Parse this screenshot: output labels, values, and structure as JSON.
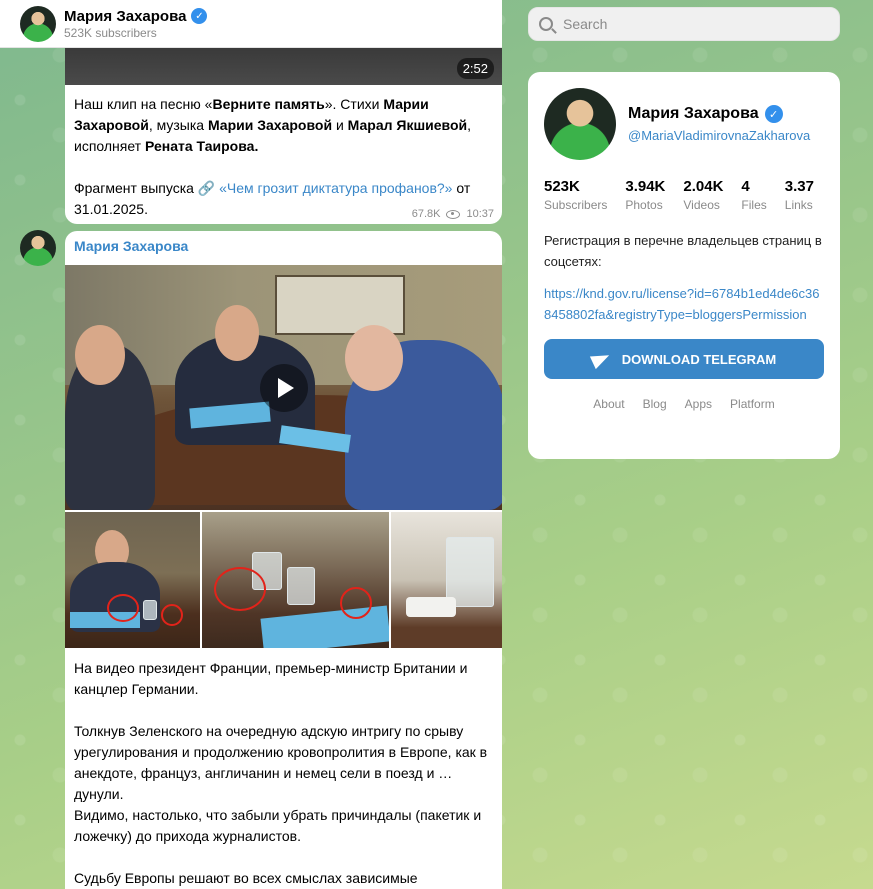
{
  "channel": {
    "name": "Мария Захарова",
    "subscribers_label": "523K subscribers",
    "handle": "@MariaVladimirovnaZakharova"
  },
  "post1": {
    "duration": "2:52",
    "line1_a": "Наш клип на песню «",
    "line1_b": "Верните память",
    "line1_c": "». Стихи ",
    "line1_d": "Марии",
    "line2_a": "Захаровой",
    "line2_b": ", музыка ",
    "line2_c": "Марии Захаровой",
    "line2_d": " и ",
    "line2_e": "Марал Якшиевой",
    "line2_f": ",",
    "line3_a": "исполняет ",
    "line3_b": "Рената Таирова.",
    "line4_a": "Фрагмент выпуска 🔗 ",
    "line4_link": "«Чем грозит диктатура профанов?»",
    "line4_b": " от",
    "line5": "31.01.2025.",
    "views": "67.8K",
    "time": "10:37"
  },
  "post2": {
    "author": "Мария Захарова",
    "p1": "На видео президент Франции, премьер-министр Британии и канцлер Германии.",
    "p2": "Толкнув Зеленского на очередную адскую интригу по срыву урегулирования и продолжению кровопролития в Европе, как в анекдоте, француз, англичанин и немец сели в поезд и … дунули.",
    "p3": "Видимо, настолько, что забыли убрать причиндалы (пакетик и ложечку) до прихода журналистов.",
    "p4": "Судьбу Европы решают во всех смыслах зависимые"
  },
  "search": {
    "placeholder": "Search"
  },
  "card": {
    "name": "Мария Захарова",
    "handle": "@MariaVladimirovnaZakharova",
    "stats": [
      {
        "value": "523K",
        "label": "Subscribers"
      },
      {
        "value": "3.94K",
        "label": "Photos"
      },
      {
        "value": "2.04K",
        "label": "Videos"
      },
      {
        "value": "4",
        "label": "Files"
      },
      {
        "value": "3.37",
        "label": "Links"
      }
    ],
    "description": "Регистрация в перечне владельцев страниц в соцсетях:",
    "link": "https://knd.gov.ru/license?id=6784b1ed4de6c368458802fa&registryType=bloggersPermission",
    "download_label": "DOWNLOAD TELEGRAM",
    "footer": [
      "About",
      "Blog",
      "Apps",
      "Platform"
    ]
  },
  "colors": {
    "accent": "#3a87c8",
    "verified": "#3390ec",
    "annotation": "#e2231a"
  }
}
